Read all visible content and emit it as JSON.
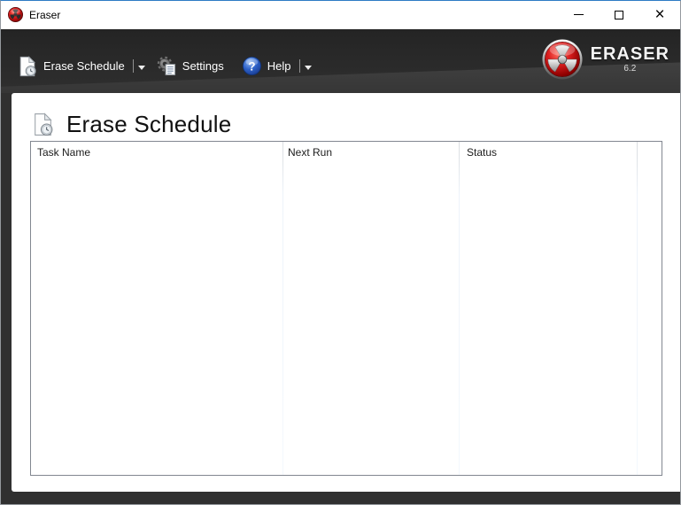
{
  "window": {
    "title": "Eraser",
    "controls": {
      "minimize_label": "minimize",
      "maximize_label": "maximize",
      "close_label": "close",
      "close_glyph": "×"
    }
  },
  "toolbar": {
    "erase_schedule": {
      "label": "Erase Schedule",
      "icon": "schedule-document-icon",
      "has_dropdown": true
    },
    "settings": {
      "label": "Settings",
      "icon": "gear-document-icon",
      "has_dropdown": false
    },
    "help": {
      "label": "Help",
      "icon": "help-question-icon",
      "glyph": "?",
      "has_dropdown": true
    },
    "brand": {
      "name": "ERASER",
      "version": "6.2",
      "icon": "radiation-logo-icon"
    }
  },
  "main": {
    "heading": {
      "text": "Erase Schedule",
      "icon": "schedule-document-icon"
    },
    "table": {
      "columns": [
        {
          "label": "Task Name"
        },
        {
          "label": "Next Run"
        },
        {
          "label": "Status"
        }
      ],
      "rows": []
    }
  },
  "colors": {
    "accent_top_border": "#2e7bc4",
    "header_dark": "#2f2f2f",
    "frame_dark": "#303030",
    "brand_red": "#c00000",
    "help_blue": "#2e62c9",
    "table_border": "#828790"
  }
}
